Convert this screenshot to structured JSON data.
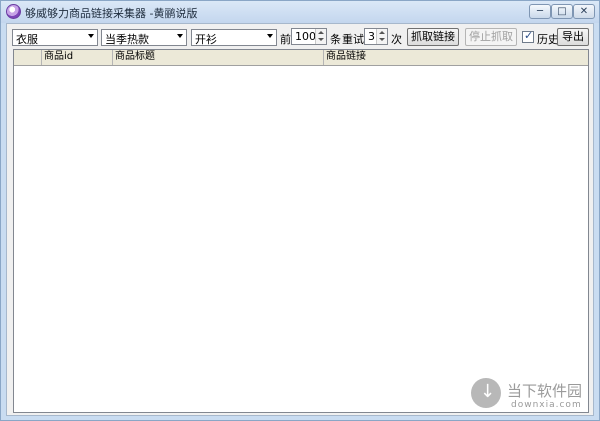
{
  "window": {
    "title": "够威够力商品链接采集器 -黄鹂说版"
  },
  "toolbar": {
    "category": "衣服",
    "season": "当季热款",
    "type": "开衫",
    "first_label": "前",
    "count_value": "100",
    "count_unit": "条",
    "retry_label": "重试",
    "retry_value": "3",
    "retry_unit": "次",
    "fetch_button": "抓取链接",
    "stop_button": "停止抓取",
    "history_label": "历史",
    "history_checked": true,
    "export_button": "导出"
  },
  "table": {
    "columns": [
      "商品id",
      "商品标题",
      "商品链接"
    ],
    "rows": []
  },
  "watermark": {
    "brand": "当下软件园",
    "url": "downxia.com"
  }
}
